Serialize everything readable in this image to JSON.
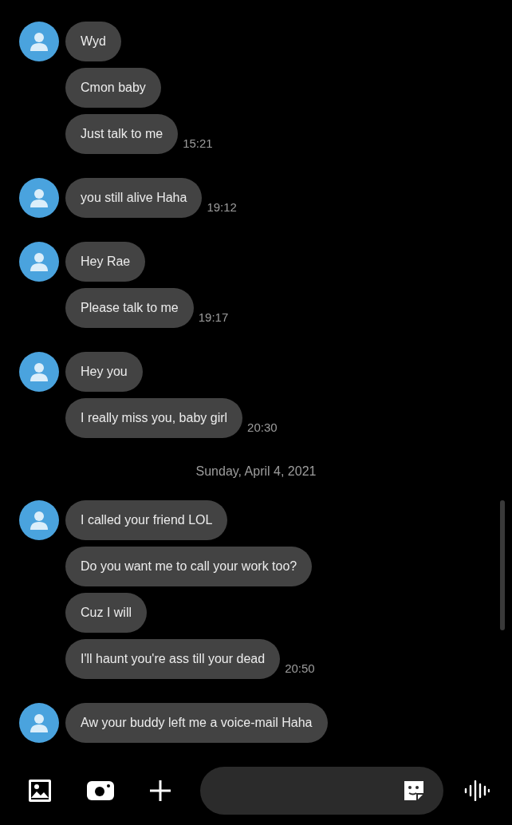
{
  "conversation": [
    {
      "kind": "messages",
      "messages": [
        {
          "text": "Wyd"
        },
        {
          "text": "Cmon baby"
        },
        {
          "text": "Just talk to me",
          "time": "15:21"
        }
      ]
    },
    {
      "kind": "messages",
      "messages": [
        {
          "text": "you still alive Haha",
          "time": "19:12"
        }
      ]
    },
    {
      "kind": "messages",
      "messages": [
        {
          "text": "Hey Rae"
        },
        {
          "text": "Please talk to me",
          "time": "19:17"
        }
      ]
    },
    {
      "kind": "messages",
      "messages": [
        {
          "text": "Hey you"
        },
        {
          "text": "I really miss you, baby girl",
          "time": "20:30"
        }
      ]
    },
    {
      "kind": "date",
      "text": "Sunday, April 4, 2021"
    },
    {
      "kind": "messages",
      "messages": [
        {
          "text": "I called your friend LOL"
        },
        {
          "text": "Do you want me to call your work too?"
        },
        {
          "text": "Cuz I will"
        },
        {
          "text": "I'll haunt you're ass till your dead",
          "time": "20:50"
        }
      ]
    },
    {
      "kind": "messages",
      "messages": [
        {
          "text": "Aw your buddy left me a voice-mail Haha"
        }
      ]
    }
  ]
}
